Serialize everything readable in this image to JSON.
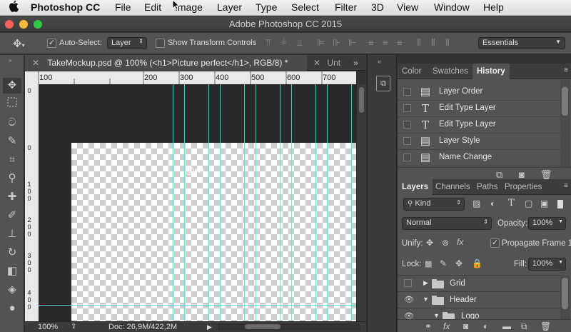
{
  "menubar": {
    "apple": "",
    "app_name": "Photoshop CC",
    "items": [
      "File",
      "Edit",
      "Image",
      "Layer",
      "Type",
      "Select",
      "Filter",
      "3D",
      "View",
      "Window",
      "Help"
    ]
  },
  "window": {
    "title": "Adobe Photoshop CC 2015",
    "traffic_lights": {
      "close": "#fc605b",
      "minimize": "#fdbc40",
      "zoom": "#34c84a"
    }
  },
  "options": {
    "auto_select_label": "Auto-Select:",
    "auto_select_checked": true,
    "auto_select_value": "Layer",
    "show_transform_label": "Show Transform Controls",
    "show_transform_checked": false,
    "workspace": "Essentials"
  },
  "doc_tabs": {
    "active": "TakeMockup.psd @ 100% (<h1>Picture perfect</h1>, RGB/8) *",
    "inactive": "Unt",
    "overflow": "»"
  },
  "ruler": {
    "h_ticks": [
      "100",
      "200",
      "300",
      "400",
      "500",
      "600",
      "700"
    ],
    "v_ticks": [
      [
        "0"
      ],
      [
        "0"
      ],
      [
        "1",
        "0",
        "0"
      ],
      [
        "2",
        "0",
        "0"
      ],
      [
        "3",
        "0",
        "0"
      ],
      [
        "4",
        "0",
        "0"
      ]
    ]
  },
  "status": {
    "zoom": "100%",
    "doc": "Doc: 26,9M/422,2M"
  },
  "history_panel": {
    "tabs": [
      "Color",
      "Swatches",
      "History"
    ],
    "active_tab": "History",
    "items": [
      {
        "icon": "document-icon",
        "label": "Layer Order"
      },
      {
        "icon": "type-icon",
        "label": "Edit Type Layer"
      },
      {
        "icon": "type-icon",
        "label": "Edit Type Layer"
      },
      {
        "icon": "document-icon",
        "label": "Layer Style"
      },
      {
        "icon": "document-icon",
        "label": "Name Change"
      }
    ]
  },
  "layers_panel": {
    "tabs": [
      "Layers",
      "Channels",
      "Paths",
      "Properties"
    ],
    "active_tab": "Layers",
    "filter_kind": "Kind",
    "blend_mode": "Normal",
    "opacity_label": "Opacity:",
    "opacity": "100%",
    "unify_label": "Unify:",
    "propagate_label": "Propagate Frame 1",
    "propagate_checked": true,
    "lock_label": "Lock:",
    "fill_label": "Fill:",
    "fill": "100%",
    "layers": [
      {
        "name": "Grid",
        "visible": false,
        "expanded": false,
        "indent": 0
      },
      {
        "name": "Header",
        "visible": true,
        "expanded": true,
        "indent": 0
      },
      {
        "name": "Logo",
        "visible": true,
        "expanded": true,
        "indent": 1
      }
    ]
  },
  "colors": {
    "guide": "#6fd6d6",
    "panel_bg": "#535353",
    "canvas_bg": "#282828"
  }
}
